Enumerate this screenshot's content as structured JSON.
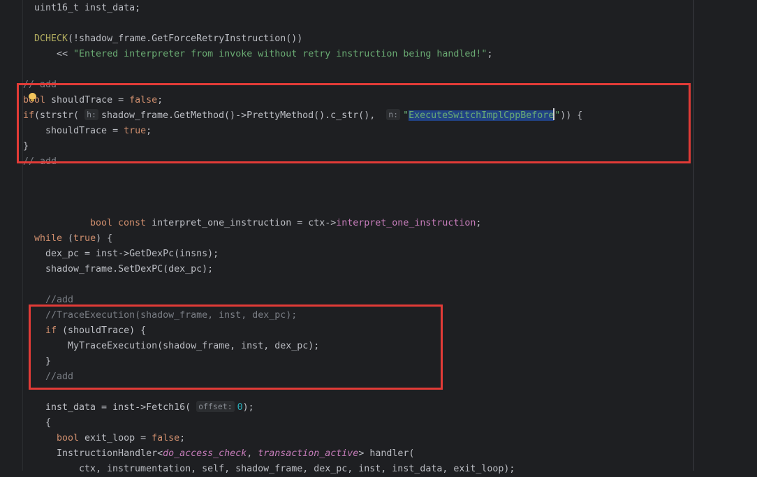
{
  "editor": {
    "code_lines": [
      {
        "id": "l1",
        "parts": [
          {
            "t": "uint16_t inst_data;"
          }
        ]
      },
      {
        "id": "l3",
        "parts": [
          {
            "t": "DCHECK",
            "c": "mac"
          },
          {
            "t": "(!shadow_frame.GetForceRetryInstruction())"
          }
        ]
      },
      {
        "id": "l4",
        "parts": [
          {
            "t": "<< "
          },
          {
            "t": "\"Entered interpreter from invoke without retry instruction being handled!\"",
            "c": "str"
          },
          {
            "t": ";"
          }
        ]
      },
      {
        "id": "l6",
        "parts": [
          {
            "t": "// add",
            "c": "cm"
          }
        ]
      },
      {
        "id": "l7",
        "parts": [
          {
            "t": "bool",
            "c": "kw"
          },
          {
            "t": " shouldTrace = "
          },
          {
            "t": "false",
            "c": "kw"
          },
          {
            "t": ";"
          }
        ]
      },
      {
        "id": "l8",
        "parts": [
          {
            "t": "if",
            "c": "kw"
          },
          {
            "t": "(strstr( "
          },
          {
            "hint": "h:"
          },
          {
            "t": "shadow_frame.GetMethod()->PrettyMethod().c_str(),  "
          },
          {
            "hint": "n:"
          },
          {
            "t": "\"",
            "c": "str"
          },
          {
            "t": "ExecuteSwitchImplCppBefore",
            "c": "str sel"
          },
          {
            "caret": true
          },
          {
            "t": "\"",
            "c": "str"
          },
          {
            "t": ")) {"
          }
        ]
      },
      {
        "id": "l9",
        "parts": [
          {
            "t": "shouldTrace = "
          },
          {
            "t": "true",
            "c": "kw"
          },
          {
            "t": ";"
          }
        ]
      },
      {
        "id": "l10",
        "parts": [
          {
            "t": "}"
          }
        ]
      },
      {
        "id": "l11",
        "parts": [
          {
            "t": "// add",
            "c": "cm"
          }
        ]
      },
      {
        "id": "l15",
        "parts": [
          {
            "t": "bool const",
            "c": "kw"
          },
          {
            "t": " interpret_one_instruction = ctx->"
          },
          {
            "t": "interpret_one_instruction",
            "c": "fld"
          },
          {
            "t": ";"
          }
        ]
      },
      {
        "id": "l16",
        "parts": [
          {
            "t": "while",
            "c": "kw"
          },
          {
            "t": " ("
          },
          {
            "t": "true",
            "c": "kw"
          },
          {
            "t": ") {"
          }
        ]
      },
      {
        "id": "l17",
        "parts": [
          {
            "t": "dex_pc = inst->GetDexPc(insns);"
          }
        ]
      },
      {
        "id": "l18",
        "parts": [
          {
            "t": "shadow_frame.SetDexPC(dex_pc);"
          }
        ]
      },
      {
        "id": "l20",
        "parts": [
          {
            "t": "//add",
            "c": "cm"
          }
        ]
      },
      {
        "id": "l21",
        "parts": [
          {
            "t": "//TraceExecution(shadow_frame, inst, dex_pc);",
            "c": "cm"
          }
        ]
      },
      {
        "id": "l22",
        "parts": [
          {
            "t": "if",
            "c": "kw"
          },
          {
            "t": " (shouldTrace) {"
          }
        ]
      },
      {
        "id": "l23",
        "parts": [
          {
            "t": "MyTraceExecution(shadow_frame, inst, dex_pc);"
          }
        ]
      },
      {
        "id": "l24",
        "parts": [
          {
            "t": "}"
          }
        ]
      },
      {
        "id": "l25",
        "parts": [
          {
            "t": "//add",
            "c": "cm"
          }
        ]
      },
      {
        "id": "l27",
        "parts": [
          {
            "t": "inst_data = inst->Fetch16( "
          },
          {
            "hint": "offset:"
          },
          {
            "t": "0",
            "c": "num"
          },
          {
            "t": ");"
          }
        ]
      },
      {
        "id": "l28",
        "parts": [
          {
            "t": "{"
          }
        ]
      },
      {
        "id": "l29",
        "parts": [
          {
            "t": "bool",
            "c": "kw"
          },
          {
            "t": " exit_loop = "
          },
          {
            "t": "false",
            "c": "kw"
          },
          {
            "t": ";"
          }
        ]
      },
      {
        "id": "l30",
        "parts": [
          {
            "t": "InstructionHandler<"
          },
          {
            "t": "do_access_check",
            "c": "tparam"
          },
          {
            "t": ", "
          },
          {
            "t": "transaction_active",
            "c": "tparam"
          },
          {
            "t": "> handler("
          }
        ]
      },
      {
        "id": "l31",
        "parts": [
          {
            "t": "ctx, instrumentation, self, shadow_frame, dex_pc, inst, inst_data, exit_loop);"
          }
        ]
      }
    ]
  },
  "colors": {
    "background": "#1e1f22",
    "annotation_box": "#e23b37",
    "selection": "#214283",
    "lightbulb": "#f2c55c"
  },
  "icons": {
    "intention": "lightbulb-icon"
  }
}
